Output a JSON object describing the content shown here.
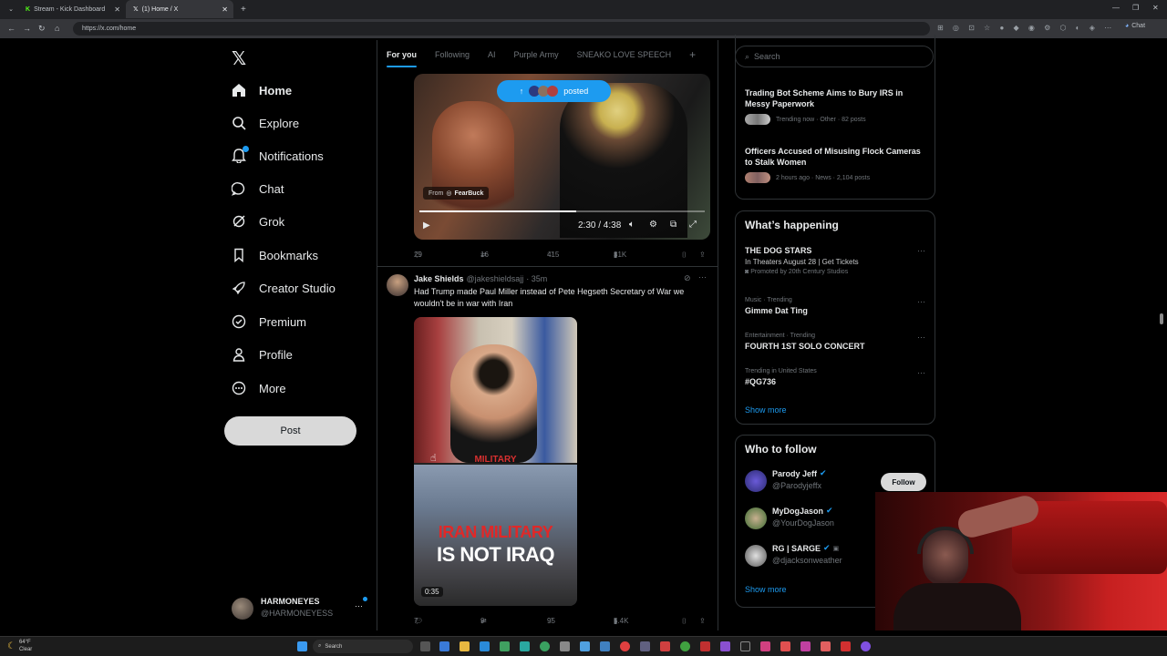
{
  "browser": {
    "tabs": [
      {
        "label": "Stream - Kick Dashboard",
        "active": false
      },
      {
        "label": "(1) Home / X",
        "active": true
      }
    ],
    "url": "https://x.com/home",
    "right_button": "Chat"
  },
  "sidebar": {
    "items": [
      {
        "label": "Home",
        "icon": "home-icon"
      },
      {
        "label": "Explore",
        "icon": "search-icon"
      },
      {
        "label": "Notifications",
        "icon": "bell-icon"
      },
      {
        "label": "Chat",
        "icon": "chat-icon"
      },
      {
        "label": "Grok",
        "icon": "grok-icon"
      },
      {
        "label": "Bookmarks",
        "icon": "bookmark-icon"
      },
      {
        "label": "Creator Studio",
        "icon": "rocket-icon"
      },
      {
        "label": "Premium",
        "icon": "verified-icon"
      },
      {
        "label": "Profile",
        "icon": "person-icon"
      },
      {
        "label": "More",
        "icon": "more-circle-icon"
      }
    ],
    "post_label": "Post",
    "account": {
      "name": "HARMONEYES",
      "handle": "@HARMONEYESS"
    }
  },
  "feed": {
    "tabs": [
      "For you",
      "Following",
      "AI",
      "Purple Army",
      "SNEAKO LOVE SPEECH"
    ],
    "add_tab": "+",
    "posted_pill": "posted",
    "video1": {
      "source_label": "From",
      "source_name": "FearBuck",
      "time": "2:30 / 4:38",
      "progress": 0.55
    },
    "tweet1_actions": {
      "replies": "29",
      "reposts": "16",
      "likes": "415",
      "views": "31K"
    },
    "tweet2": {
      "name": "Jake Shields",
      "handle": "@jakeshieldsajj",
      "time": "· 35m",
      "text": "Had Trump made Paul Miller instead of Pete Hegseth Secretary of War we wouldn't be in war with Iran",
      "video_caption_top": "MILITARY",
      "video_caption_big": [
        "IRAN MILITARY",
        "IS NOT IRAQ"
      ],
      "duration": "0:35",
      "actions": {
        "replies": "7",
        "reposts": "9",
        "likes": "95",
        "views": "5.4K"
      }
    }
  },
  "right": {
    "search_placeholder": "Search",
    "news": [
      {
        "title": "Trading Bot Scheme Aims to Bury IRS in Messy Paperwork",
        "meta": "Trending now · Other · 82 posts"
      },
      {
        "title": "Officers Accused of Misusing Flock Cameras to Stalk Women",
        "meta": "2 hours ago · News · 2,104 posts"
      }
    ],
    "happening": {
      "title": "What’s happening",
      "items": [
        {
          "meta": "",
          "title": "THE DOG STARS",
          "sub": "In Theaters August 28 | Get Tickets",
          "promo": "Promoted by 20th Century Studios"
        },
        {
          "meta": "Music · Trending",
          "title": "Gimme Dat Ting"
        },
        {
          "meta": "Entertainment · Trending",
          "title": "FOURTH 1ST SOLO CONCERT"
        },
        {
          "meta": "Trending in United States",
          "title": "#QG736"
        }
      ],
      "show_more": "Show more"
    },
    "who_to_follow": {
      "title": "Who to follow",
      "people": [
        {
          "name": "Parody Jeff",
          "handle": "@Parodyjeffx"
        },
        {
          "name": "MyDogJason",
          "handle": "@YourDogJason"
        },
        {
          "name": "RG | SARGE",
          "handle": "@djacksonweather"
        }
      ],
      "follow_label": "Follow",
      "show_more": "Show more"
    }
  },
  "taskbar": {
    "weather_temp": "64°F",
    "weather_cond": "Clear",
    "search_label": "Search"
  },
  "colors": {
    "accent": "#1d9bf0",
    "background": "#000000",
    "border": "#2f3336"
  }
}
